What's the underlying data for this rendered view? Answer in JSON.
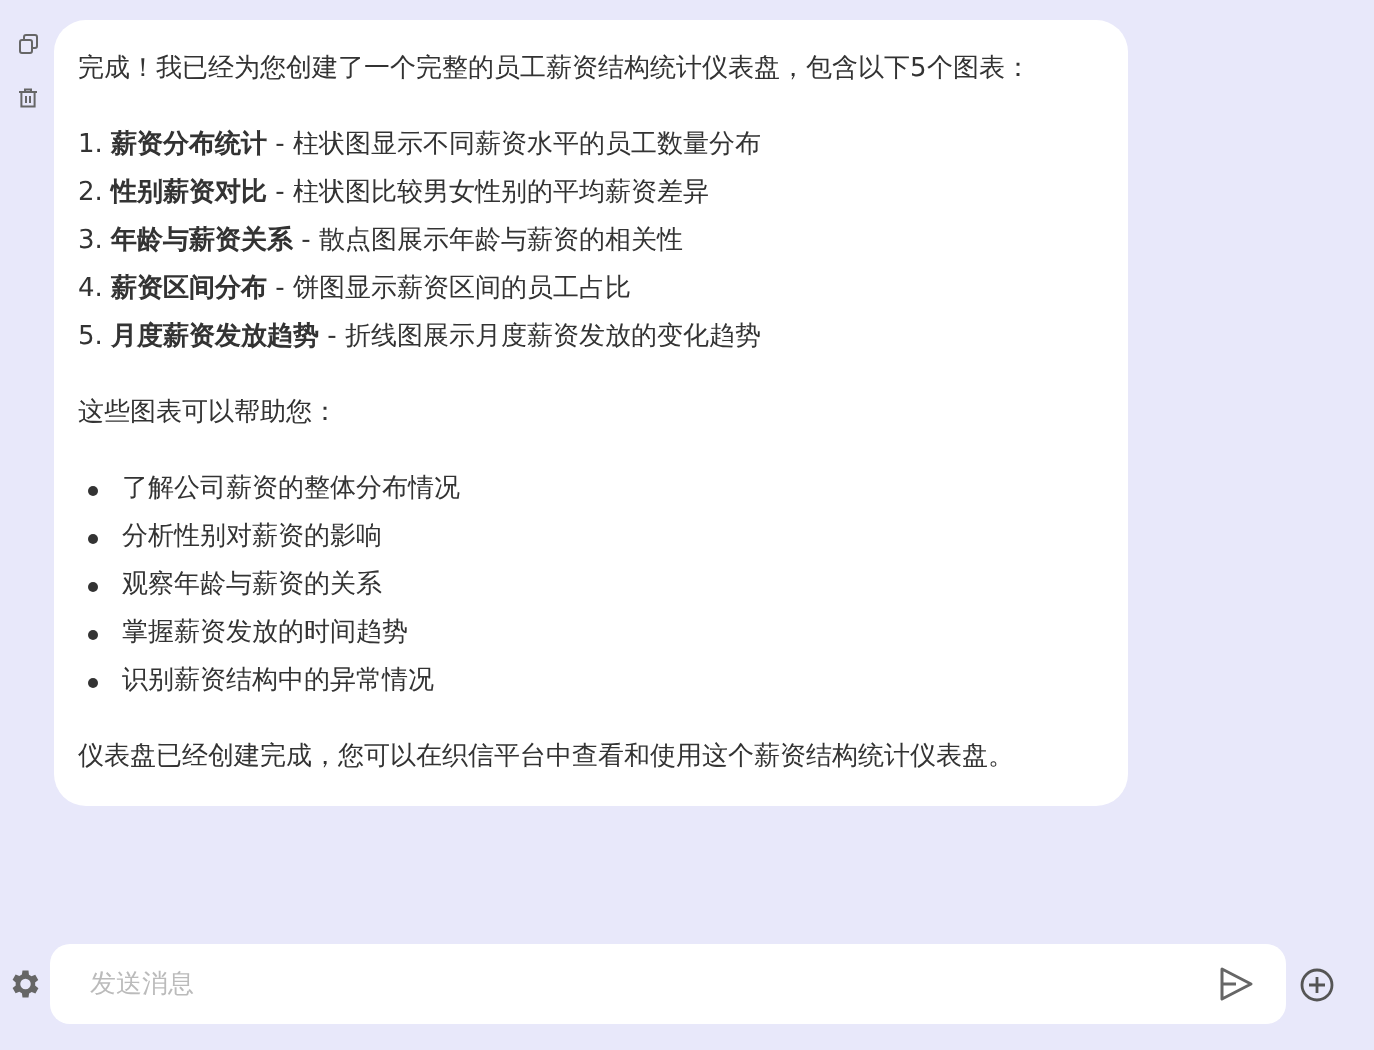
{
  "message": {
    "intro": "完成！我已经为您创建了一个完整的员工薪资结构统计仪表盘，包含以下5个图表：",
    "charts": [
      "1. **薪资分布统计** - 柱状图显示不同薪资水平的员工数量分布",
      "2. **性别薪资对比** - 柱状图比较男女性别的平均薪资差异",
      "3. **年龄与薪资关系** - 散点图展示年龄与薪资的相关性",
      "4. **薪资区间分布** - 饼图显示薪资区间的员工占比",
      "5. **月度薪资发放趋势** - 折线图展示月度薪资发放的变化趋势"
    ],
    "benefits_intro": "这些图表可以帮助您：",
    "benefits": [
      "了解公司薪资的整体分布情况",
      "分析性别对薪资的影响",
      "观察年龄与薪资的关系",
      "掌握薪资发放的时间趋势",
      "识别薪资结构中的异常情况"
    ],
    "closing": "仪表盘已经创建完成，您可以在织信平台中查看和使用这个薪资结构统计仪表盘。"
  },
  "composer": {
    "placeholder": "发送消息"
  }
}
